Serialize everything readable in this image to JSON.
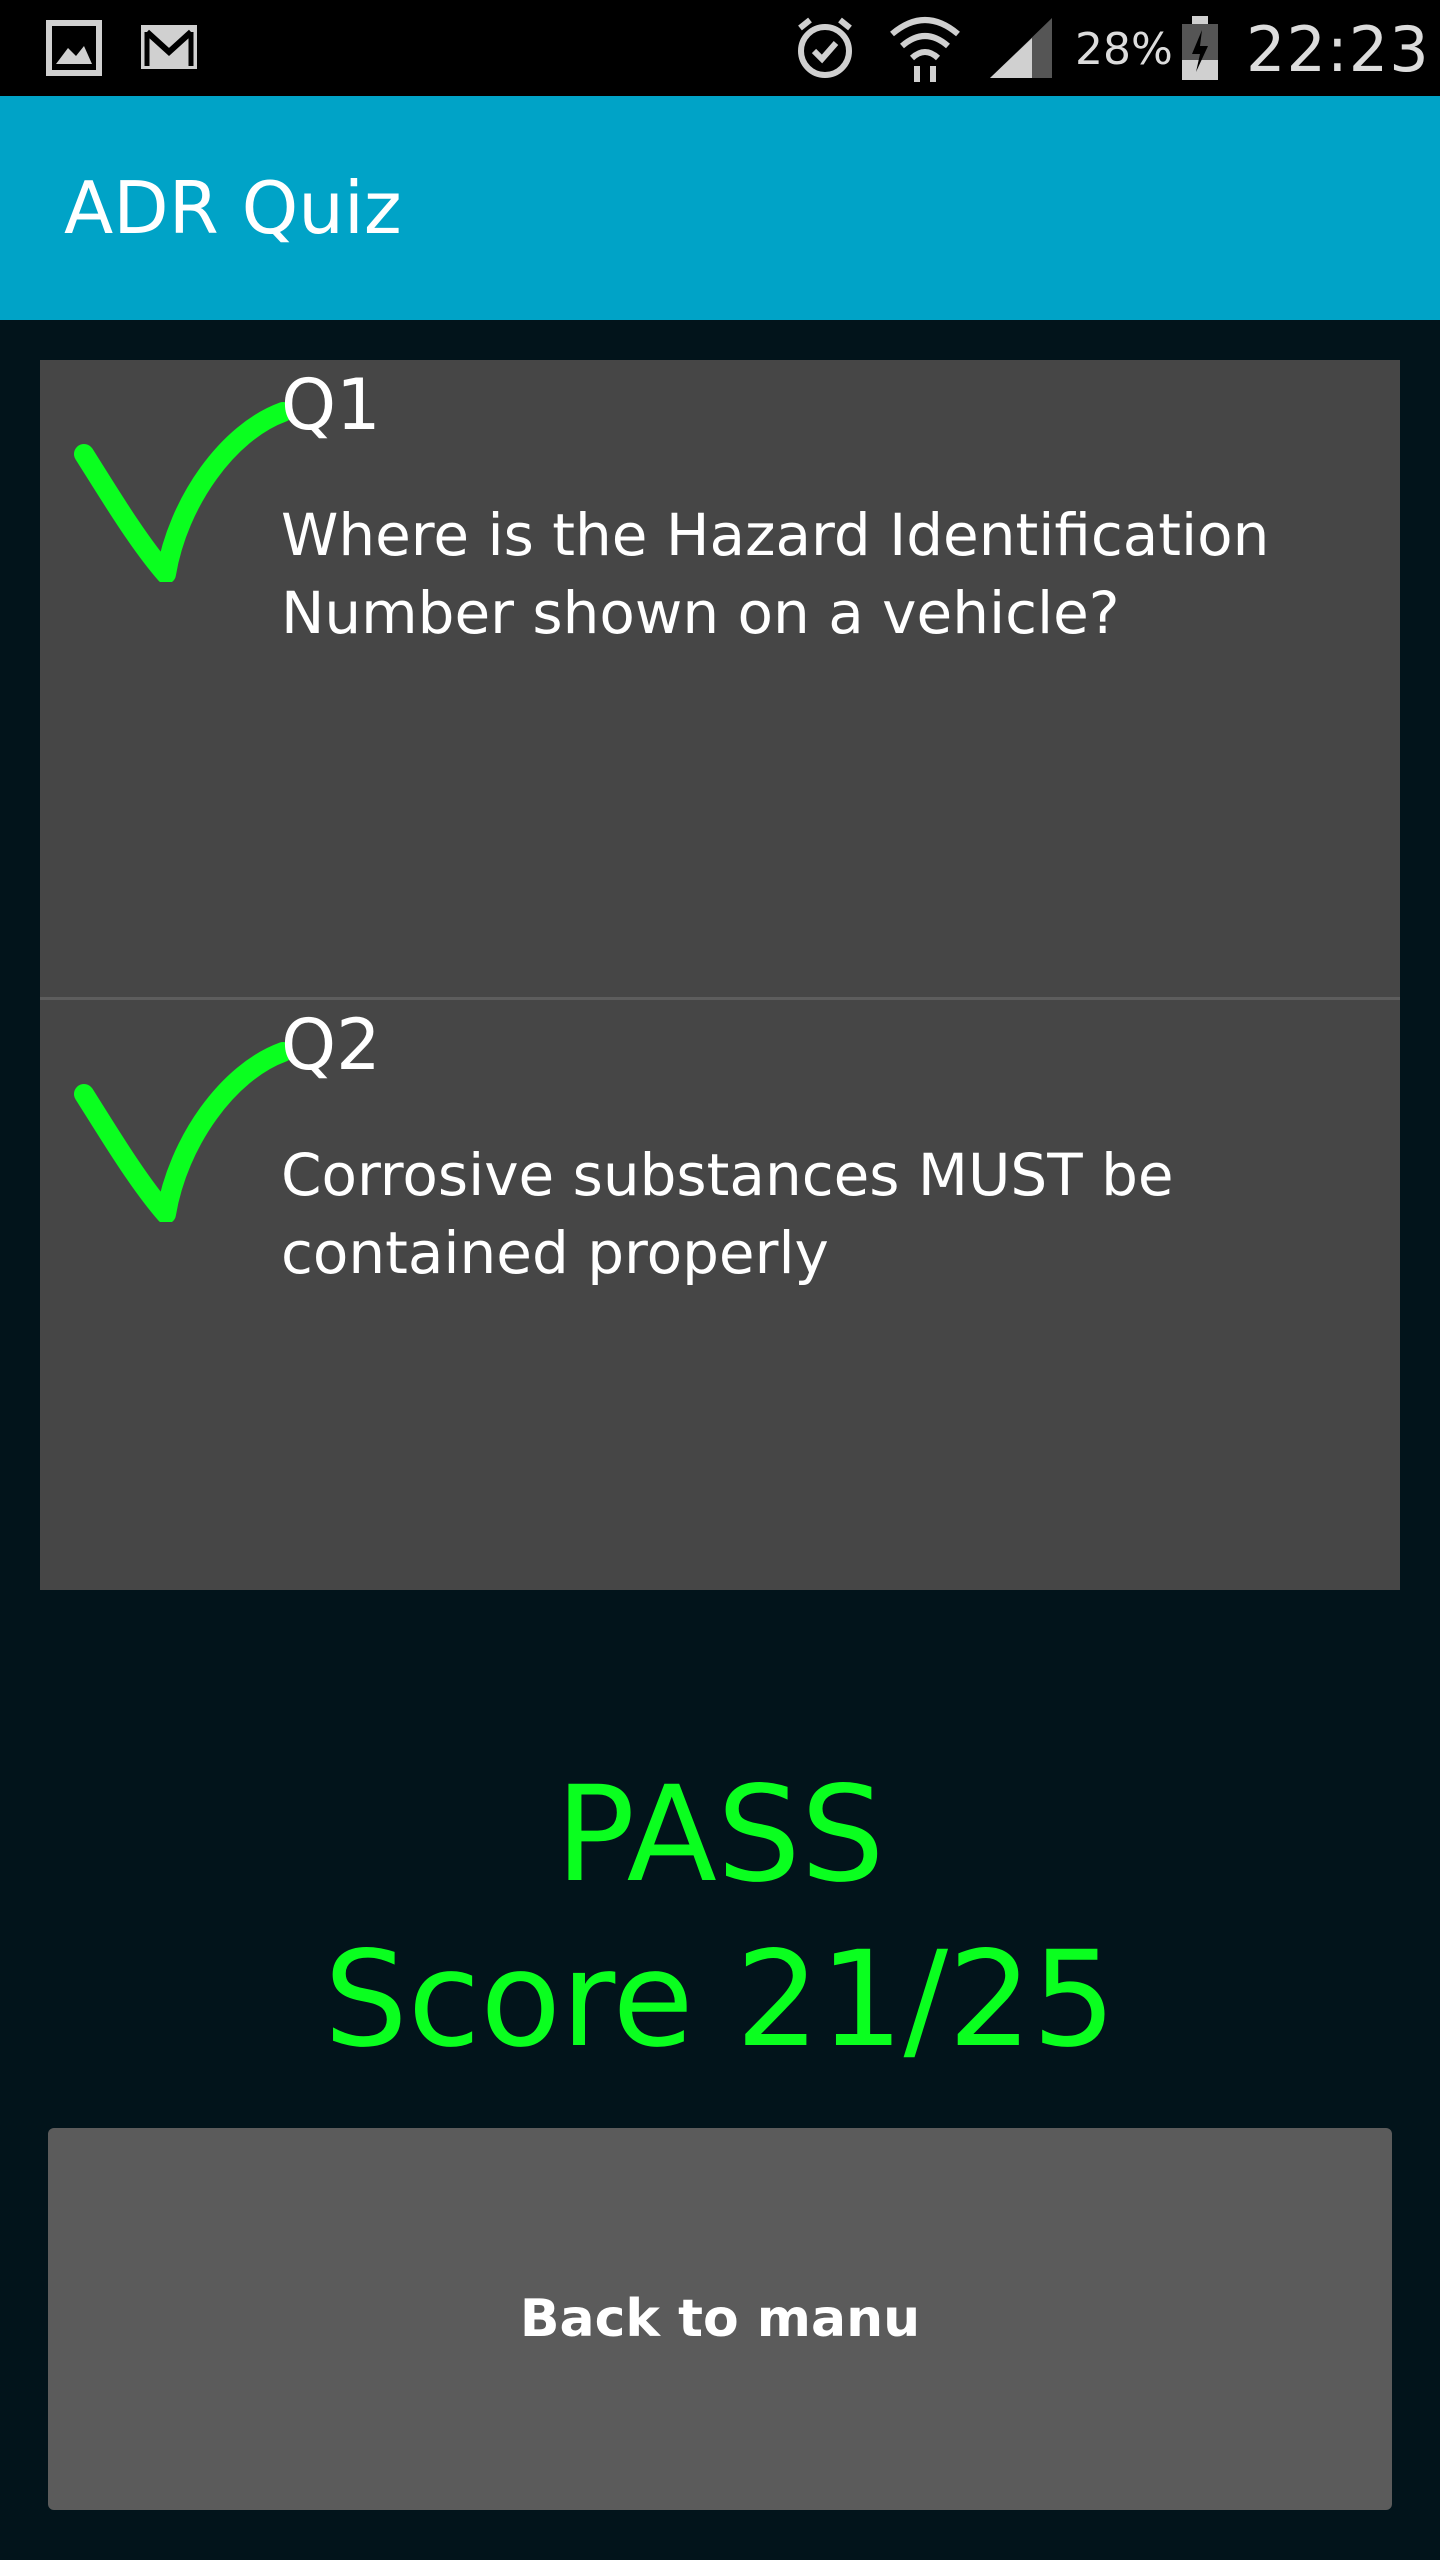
{
  "status_bar": {
    "icons": [
      "gallery-icon",
      "gmail-icon",
      "alarm-icon",
      "wifi-icon",
      "signal-icon",
      "battery-icon"
    ],
    "battery_percent": "28%",
    "clock": "22:23"
  },
  "app_bar": {
    "title": "ADR Quiz"
  },
  "questions": [
    {
      "number": "Q1",
      "text": "Where is the Hazard Identification Number shown on a vehicle?",
      "icon": "checkmark-icon"
    },
    {
      "number": "Q2",
      "text": "Corrosive substances MUST be contained properly",
      "icon": "checkmark-icon"
    }
  ],
  "result": {
    "status": "PASS",
    "score": "Score 21/25"
  },
  "back_button": {
    "label": "Back to manu"
  },
  "colors": {
    "app_bar": "#00a3c7",
    "background": "#02141b",
    "list_item": "#464646",
    "pass_green": "#0aff1f",
    "button": "#5b5b5b"
  }
}
